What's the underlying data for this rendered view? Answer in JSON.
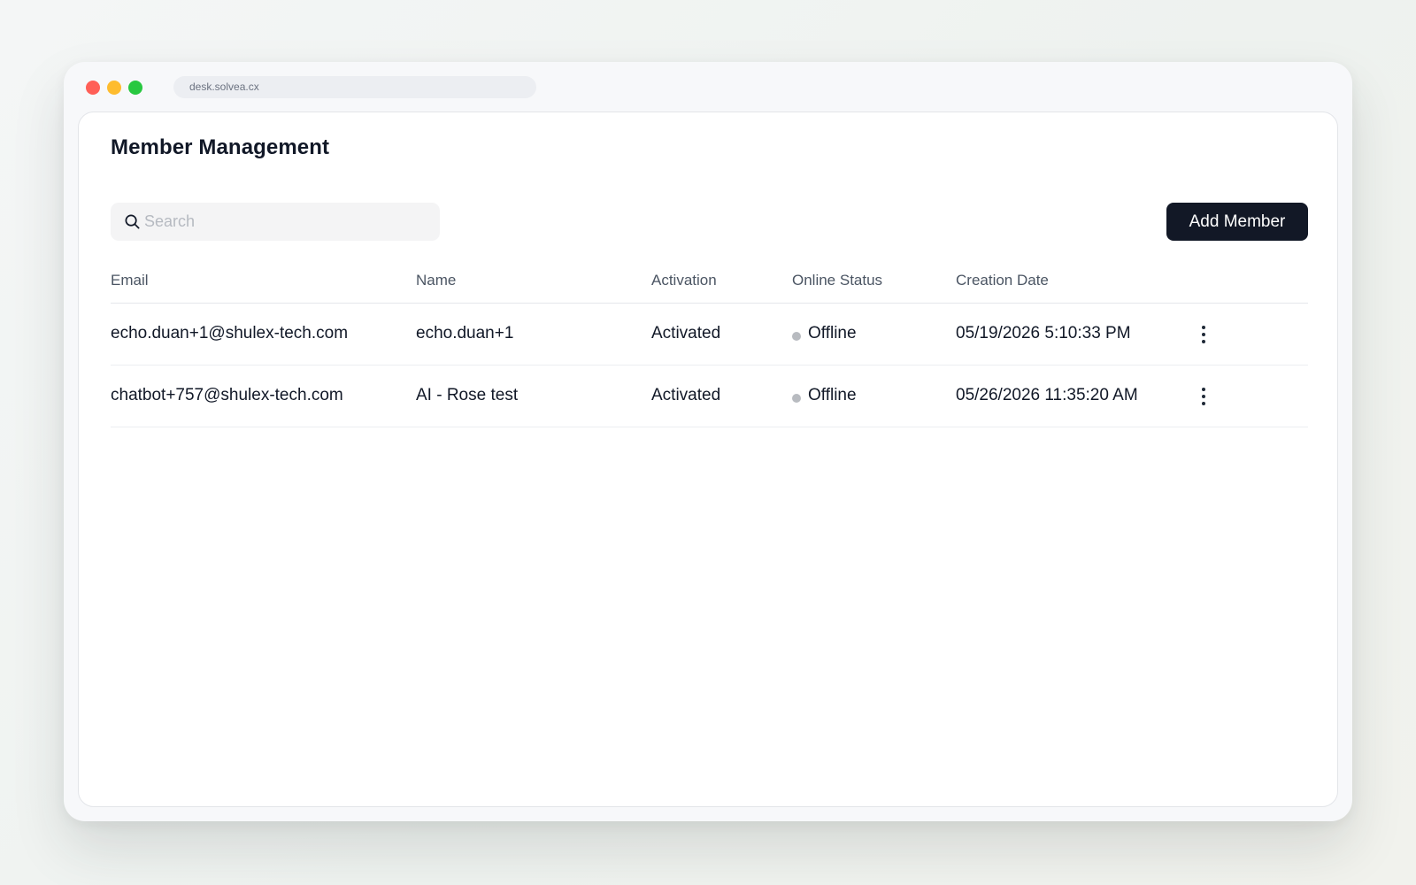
{
  "browser": {
    "url": "desk.solvea.cx",
    "traffic_lights": {
      "close": "#ff5f57",
      "minimize": "#febc2e",
      "zoom": "#28c840"
    }
  },
  "page": {
    "title": "Member Management"
  },
  "search": {
    "placeholder": "Search",
    "value": "",
    "icon": "search-icon"
  },
  "toolbar": {
    "add_member_label": "Add Member",
    "add_member_color": "#121826"
  },
  "table": {
    "columns": [
      "Email",
      "Name",
      "Activation",
      "Online Status",
      "Creation Date"
    ],
    "rows": [
      {
        "email": "echo.duan+1@shulex-tech.com",
        "name": "echo.duan+1",
        "activation": "Activated",
        "online_status": "Offline",
        "creation_date": "05/19/2026 5:10:33 PM",
        "actions_icon": "more-vertical-icon"
      },
      {
        "email": "chatbot+757@shulex-tech.com",
        "name": "AI - Rose test",
        "activation": "Activated",
        "online_status": "Offline",
        "creation_date": "05/26/2026 11:35:20 AM",
        "actions_icon": "more-vertical-icon"
      }
    ],
    "offline_dot_color": "#b8bbc0"
  }
}
